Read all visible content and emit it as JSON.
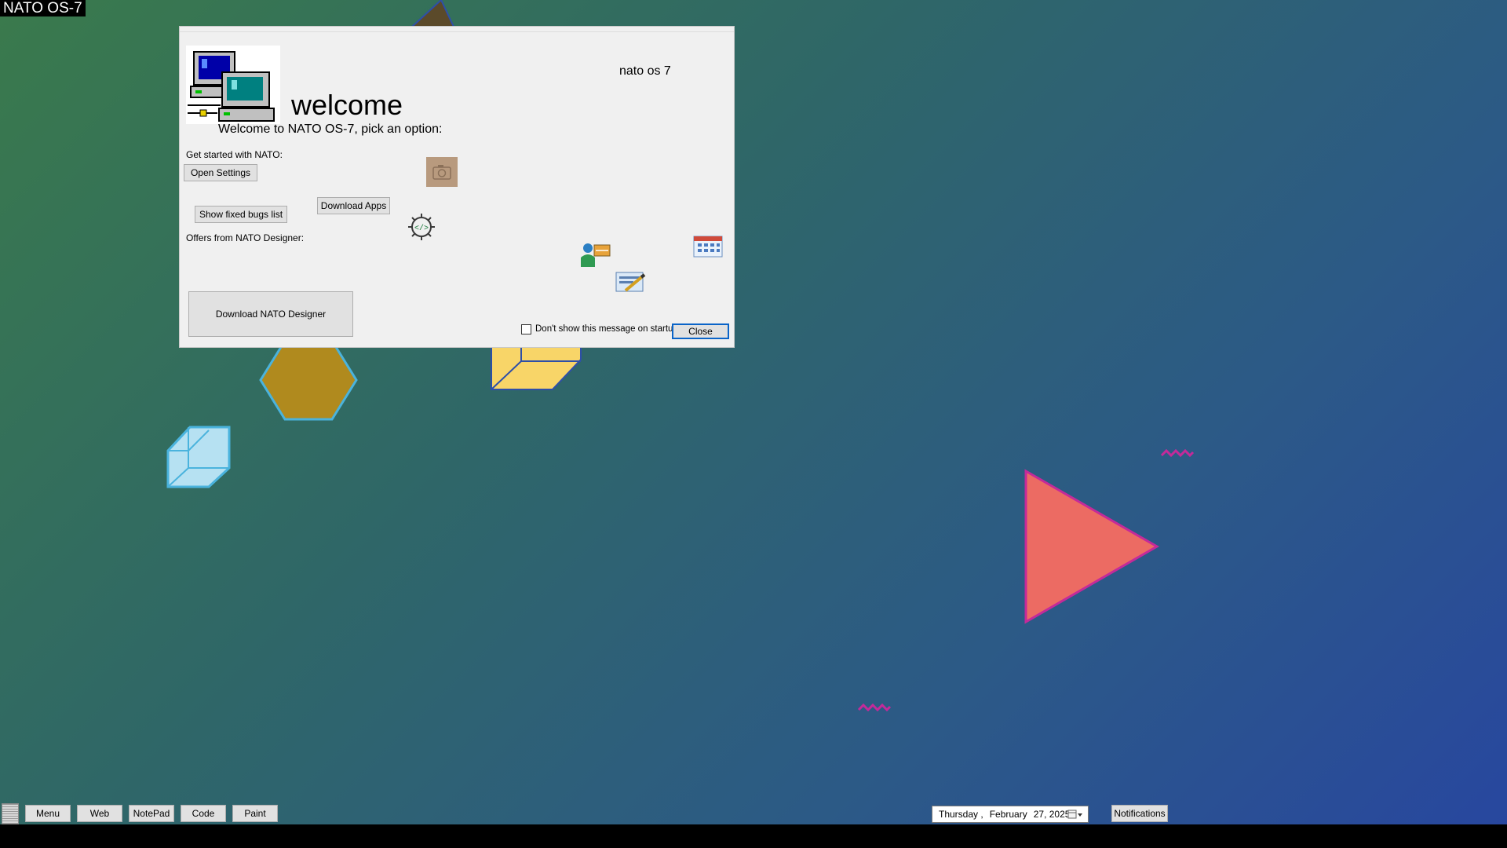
{
  "desktop": {
    "os_label": "NATO OS-7"
  },
  "welcome_window": {
    "app_name": "nato os 7",
    "heading": "welcome",
    "subtitle": "Welcome to NATO OS-7, pick an option:",
    "get_started_label": "Get started with NATO:",
    "open_settings_label": "Open Settings",
    "download_apps_label": "Download Apps",
    "show_bugs_label": "Show fixed bugs list",
    "offers_label": "Offers from NATO Designer:",
    "download_designer_label": "Download NATO Designer",
    "dont_show_label": "Don't show this message on startup",
    "dont_show_checked": false,
    "close_label": "Close"
  },
  "taskbar": {
    "buttons": [
      "Menu",
      "Web",
      "NotePad",
      "Code",
      "Paint"
    ],
    "date": {
      "weekday": "Thursday",
      "sep": " ,",
      "month": "February",
      "day_year": "27, 2025"
    },
    "notifications_label": "Notifications"
  },
  "colors": {
    "hexagon": "#b08a1e",
    "play_triangle": "#ec6b63",
    "accent_pink": "#d43fa0",
    "close_border": "#0a64c8"
  }
}
